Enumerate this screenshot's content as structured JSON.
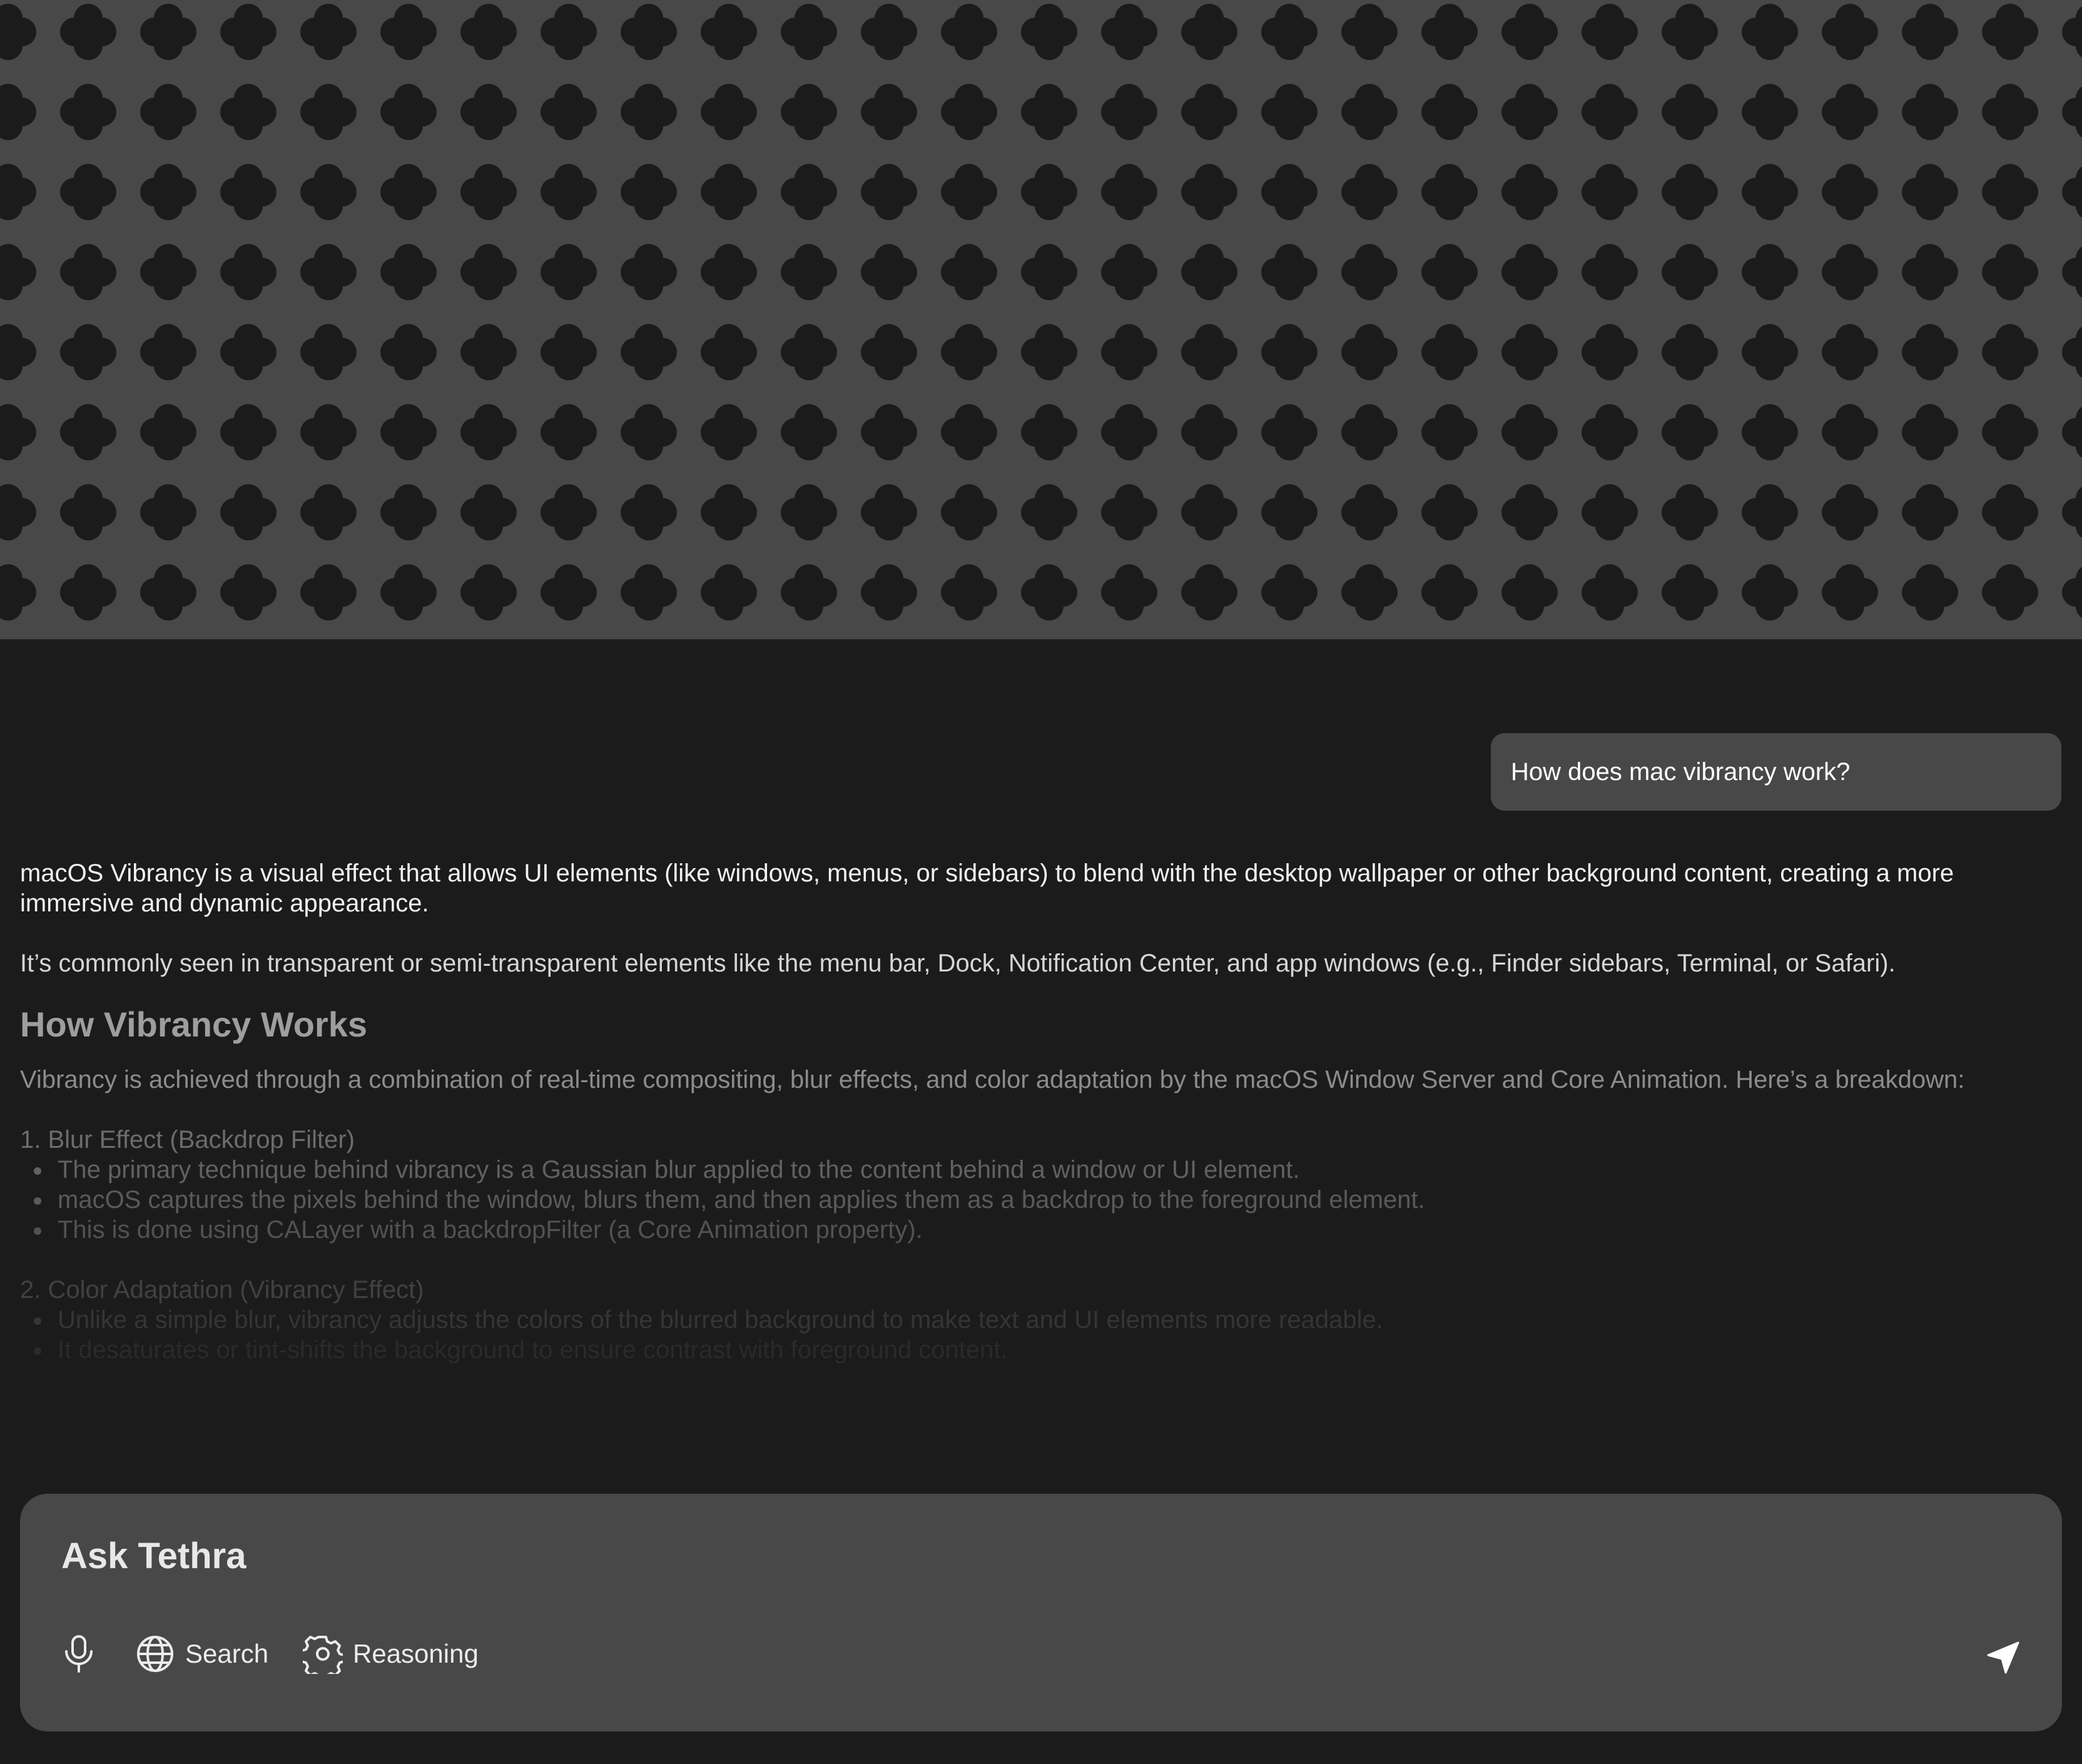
{
  "conversation": {
    "user_message": "How does mac vibrancy work?",
    "answer": {
      "intro_paragraphs": [
        "macOS Vibrancy is a visual effect that allows UI elements (like windows, menus, or sidebars) to blend with the desktop wallpaper or other background content, creating a more immersive and dynamic appearance.",
        " It’s commonly seen in transparent or semi-transparent elements like the menu bar, Dock, Notification Center, and app windows (e.g., Finder sidebars, Terminal, or Safari)."
      ],
      "heading": "How Vibrancy Works",
      "heading_paragraph": "Vibrancy is achieved through a combination of real-time compositing, blur effects, and color adaptation by the macOS Window Server and Core Animation. Here’s a breakdown:",
      "sections": [
        {
          "title": "1. Blur Effect (Backdrop Filter)",
          "bullets": [
            "The primary technique behind vibrancy is a Gaussian blur applied to the content behind a window or UI element.",
            "macOS captures the pixels behind the window, blurs them, and then applies them as a backdrop to the foreground element.",
            "This is done using CALayer with a backdropFilter (a Core Animation property)."
          ]
        },
        {
          "title": "2. Color Adaptation (Vibrancy Effect)",
          "bullets": [
            "Unlike a simple blur, vibrancy adjusts the colors of the blurred background to make text and UI elements more readable.",
            "It desaturates or tint-shifts the background to ensure contrast with foreground content."
          ]
        }
      ]
    }
  },
  "composer": {
    "placeholder": "Ask Tethra",
    "tools": {
      "mic_icon": "microphone-icon",
      "search_label": "Search",
      "search_icon": "globe-icon",
      "reasoning_label": "Reasoning",
      "reasoning_icon": "gear-icon",
      "send_icon": "send-icon"
    }
  },
  "colors": {
    "background": "#1b1b1b",
    "surface": "#484848",
    "pattern_shape": "#1b1b1b",
    "text_primary": "#ffffff"
  }
}
